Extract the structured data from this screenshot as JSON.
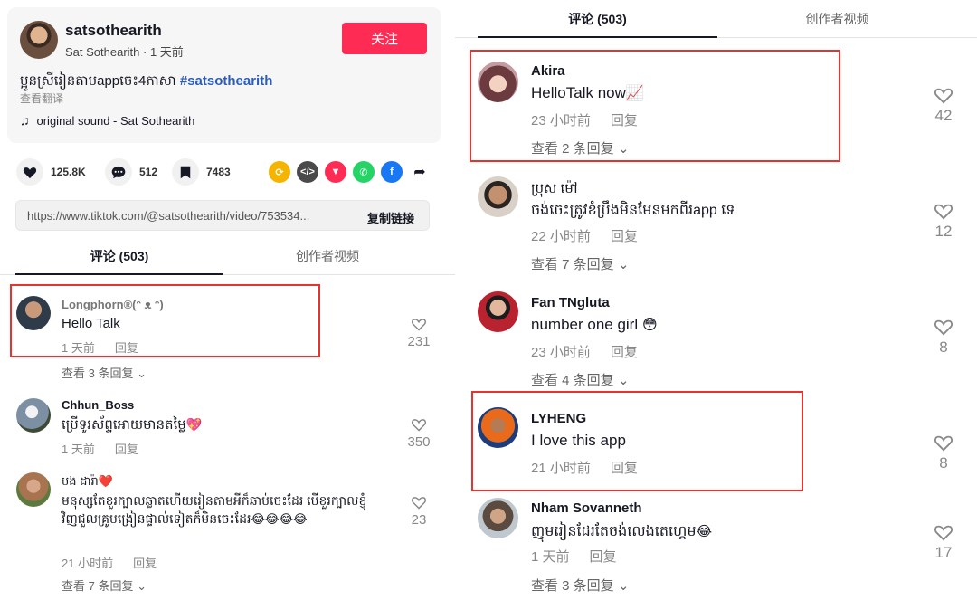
{
  "post": {
    "author_name": "satsothearith",
    "author_meta": "Sat Sothearith · 1 天前",
    "follow_label": "关注",
    "caption_text": "ប្អូនស្រីរៀនតាមappចេះ4ភាសា ",
    "caption_hashtag": "#satsothearith",
    "translate_label": "查看翻译",
    "music_label": "original sound - Sat Sothearith"
  },
  "actions": {
    "likes": "125.8K",
    "comments": "512",
    "saves": "7483",
    "share_icons": [
      "repost-icon",
      "embed-icon",
      "send-icon",
      "whatsapp-icon",
      "facebook-icon",
      "share-arrow-icon"
    ]
  },
  "link_bar": {
    "url": "https://www.tiktok.com/@satsothearith/video/753534...",
    "copy_label": "复制链接"
  },
  "tabs": {
    "comments_label": "评论 (503)",
    "creator_videos_label": "创作者视频"
  },
  "left_comments": [
    {
      "name": "Longphorn®(ᵔ ᴥ ᵔ)",
      "text": "Hello Talk",
      "time": "1 天前",
      "reply_label": "回复",
      "likes": "231",
      "more_replies": "查看 3 条回复",
      "highlighted": true
    },
    {
      "name": "Chhun_Boss",
      "text": "ប្រើទូរស័ព្ទអោយមានតម្លៃ",
      "emoji": "💖",
      "time": "1 天前",
      "reply_label": "回复",
      "likes": "350"
    },
    {
      "name": "បង ដារ៉ា❤️",
      "text": "មនុស្សតែខួរក្បាលឆ្លាតហើយរៀនតាមអីក៏ឆាប់ចេះដែរ បើខួរក្បាលខ្ញុំវិញជួលគ្រូបង្រៀនផ្ទាល់ទៀតក៏មិនចេះដែរ",
      "emoji": "😂😂😂😂",
      "time": "21 小时前",
      "reply_label": "回复",
      "likes": "23",
      "more_replies": "查看 7 条回复"
    }
  ],
  "right_comments": [
    {
      "name": "Akira",
      "text": "HelloTalk now",
      "emoji": "📈",
      "time": "23 小时前",
      "reply_label": "回复",
      "likes": "42",
      "more_replies": "查看 2 条回复",
      "highlighted": true
    },
    {
      "name": "ប្រុស ម៉ៅ",
      "text": "ចង់ចេះត្រូវខំប្រឹងមិនមែនមកពីរapp ទេ",
      "time": "22 小时前",
      "reply_label": "回复",
      "likes": "12",
      "more_replies": "查看 7 条回复"
    },
    {
      "name": "Fan TNgluta",
      "text": "number one girl",
      "emoji": "😳",
      "time": "23 小时前",
      "reply_label": "回复",
      "likes": "8",
      "more_replies": "查看 4 条回复"
    },
    {
      "name": "LYHENG",
      "text": "I love this app",
      "time": "21 小时前",
      "reply_label": "回复",
      "likes": "8",
      "highlighted": true
    },
    {
      "name": "Nham Sovanneth",
      "text": "ញុមរៀនដែរតែចង់លេងតេហ្គេម",
      "emoji": "😂",
      "time": "1 天前",
      "reply_label": "回复",
      "likes": "17",
      "more_replies": "查看 3 条回复"
    }
  ],
  "colors": {
    "brand_red": "#fe2c55",
    "highlight_red": "#e8322d",
    "hashtag_blue": "#2b5db9"
  }
}
